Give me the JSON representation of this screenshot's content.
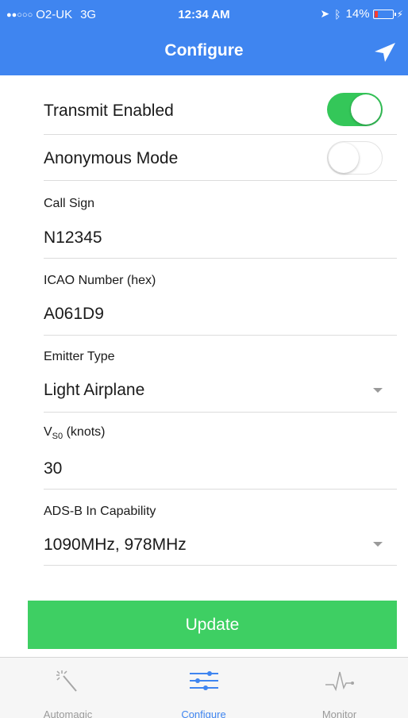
{
  "status_bar": {
    "signal": "●●○○○",
    "carrier": "O2-UK",
    "network": "3G",
    "time": "12:34 AM",
    "battery": "14%"
  },
  "nav": {
    "title": "Configure"
  },
  "form": {
    "transmit_enabled": {
      "label": "Transmit Enabled",
      "state": "on"
    },
    "anonymous_mode": {
      "label": "Anonymous Mode",
      "state": "off"
    },
    "call_sign": {
      "label": "Call Sign",
      "value": "N12345"
    },
    "icao_number": {
      "label": "ICAO Number (hex)",
      "value": "A061D9"
    },
    "emitter_type": {
      "label": "Emitter Type",
      "value": "Light Airplane"
    },
    "vso": {
      "label_prefix": "V",
      "label_sub": "S0",
      "label_suffix": " (knots)",
      "value": "30"
    },
    "adsb_in": {
      "label": "ADS-B In Capability",
      "value": "1090MHz, 978MHz"
    }
  },
  "update_button": {
    "label": "Update"
  },
  "tabs": [
    {
      "label": "Automagic",
      "icon": "magic-wand-icon"
    },
    {
      "label": "Configure",
      "icon": "sliders-icon",
      "active": true
    },
    {
      "label": "Monitor",
      "icon": "heartbeat-icon"
    }
  ],
  "colors": {
    "header": "#3f85f0",
    "toggle_on": "#34c759",
    "update_button": "#3ecf63",
    "tab_active": "#3f85f0",
    "tab_inactive": "#9a9a9a"
  }
}
